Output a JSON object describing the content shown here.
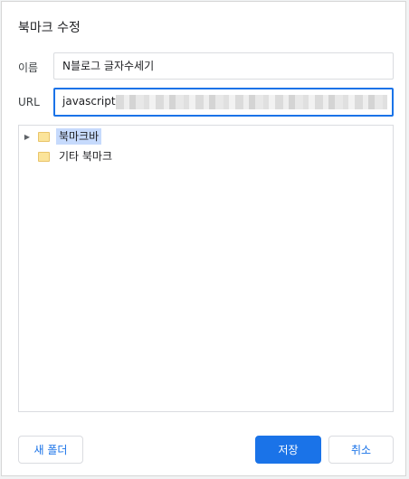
{
  "dialog": {
    "title": "북마크 수정",
    "name_label": "이름",
    "name_value": "N블로그 글자수세기",
    "url_label": "URL",
    "url_value_visible": "javascript",
    "tree": {
      "items": [
        {
          "label": "북마크바",
          "selected": true,
          "expandable": true
        },
        {
          "label": "기타 북마크",
          "selected": false,
          "expandable": false
        }
      ]
    },
    "buttons": {
      "new_folder": "새 폴더",
      "save": "저장",
      "cancel": "취소"
    }
  },
  "colors": {
    "accent": "#1a73e8",
    "selection": "#c6dafc",
    "folder": "#fbe49a"
  },
  "icons": [
    "expand-arrow-icon",
    "folder-icon"
  ]
}
